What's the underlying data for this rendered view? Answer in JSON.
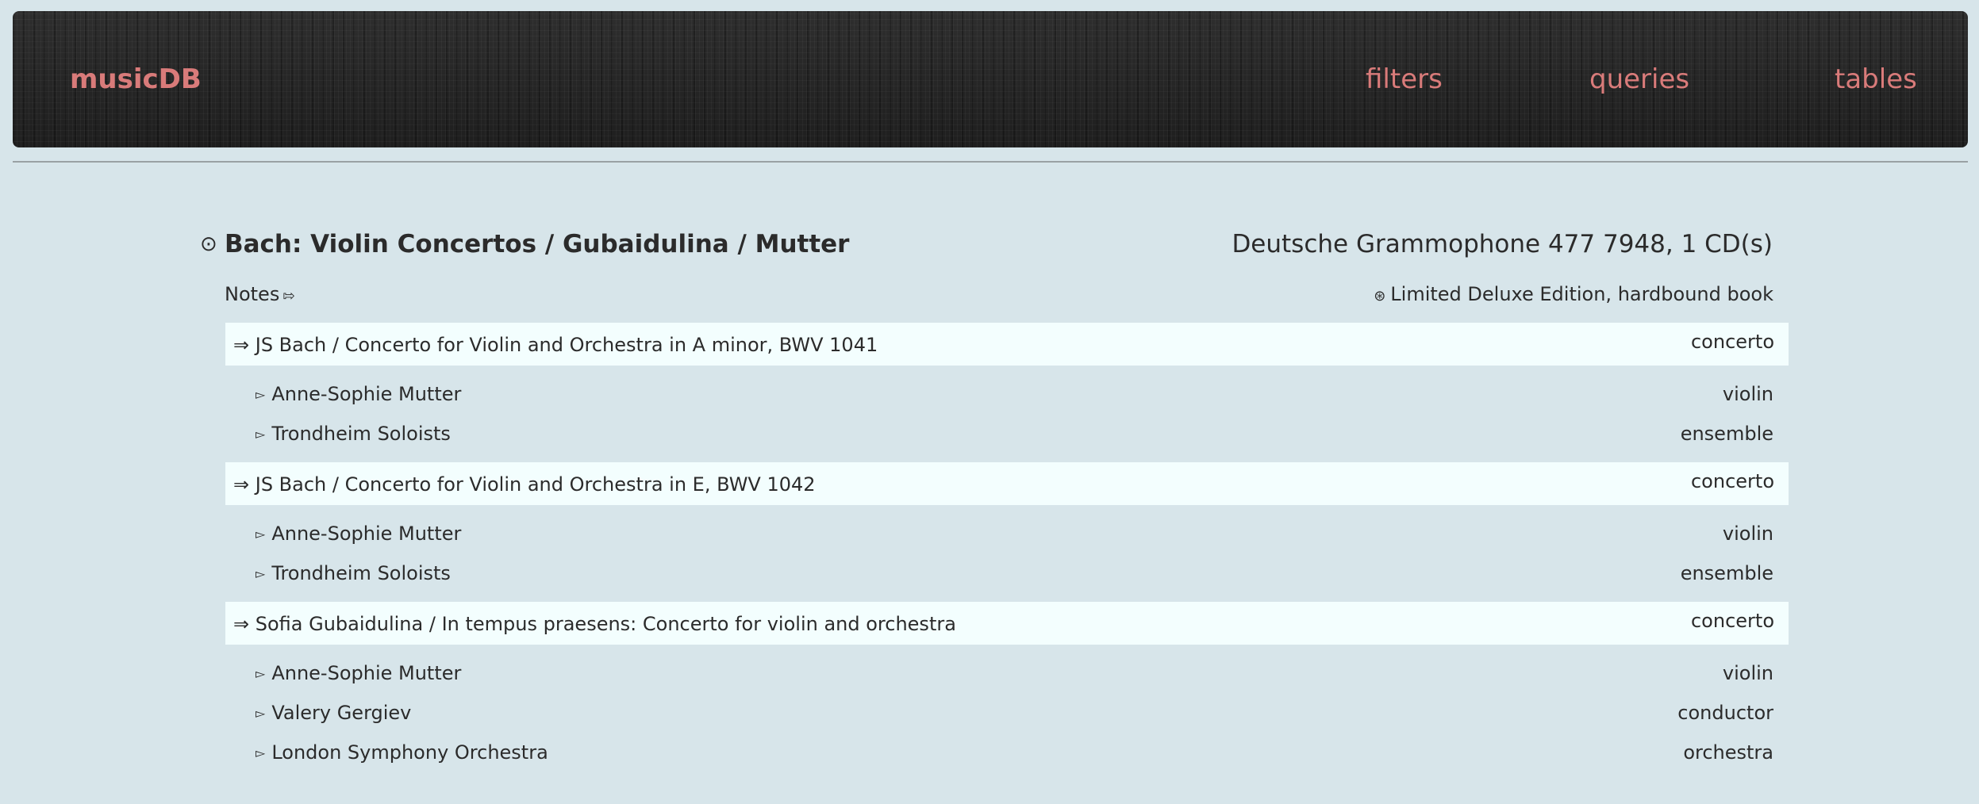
{
  "header": {
    "brand": "musicDB",
    "nav": {
      "filters": "filters",
      "queries": "queries",
      "tables": "tables"
    }
  },
  "album": {
    "toggle_icon": "⊙",
    "title": "Bach: Violin Concertos / Gubaidulina / Mutter",
    "label": "Deutsche Grammophone 477 7948, 1 CD(s)",
    "notes_label": "Notes",
    "notes_icon": "⇰",
    "edition_icon": "⊛",
    "edition": "Limited Deluxe Edition, hardbound book"
  },
  "works": [
    {
      "title": "⇒ JS Bach / Concerto for Violin and Orchestra in A minor, BWV 1041",
      "genre": "concerto",
      "performers": [
        {
          "name": "Anne-Sophie Mutter",
          "role": "violin"
        },
        {
          "name": "Trondheim Soloists",
          "role": "ensemble"
        }
      ]
    },
    {
      "title": "⇒ JS Bach / Concerto for Violin and Orchestra in E, BWV 1042",
      "genre": "concerto",
      "performers": [
        {
          "name": "Anne-Sophie Mutter",
          "role": "violin"
        },
        {
          "name": "Trondheim Soloists",
          "role": "ensemble"
        }
      ]
    },
    {
      "title": "⇒ Sofia Gubaidulina / In tempus praesens: Concerto for violin and orchestra",
      "genre": "concerto",
      "performers": [
        {
          "name": "Anne-Sophie Mutter",
          "role": "violin"
        },
        {
          "name": "Valery Gergiev",
          "role": "conductor"
        },
        {
          "name": "London Symphony Orchestra",
          "role": "orchestra"
        }
      ]
    }
  ],
  "performer_bullet": "▻",
  "colors": {
    "background": "#d7e5ea",
    "accent": "#d97b7a",
    "header_bg": "#252525",
    "work_row_bg": "#f3fefe",
    "text": "#2b2b2b"
  }
}
